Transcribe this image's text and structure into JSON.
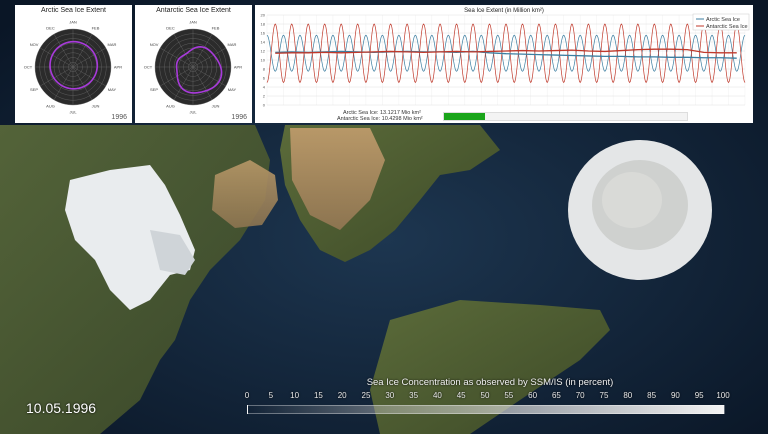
{
  "colors": {
    "arctic": "#3b7ea1",
    "antarctic": "#c0392b",
    "progress": "#1aa51a",
    "polar_trace": "#a93adc"
  },
  "arctic_panel": {
    "title": "Arctic Sea Ice Extent",
    "year": "1996",
    "months": [
      "JAN",
      "FEB",
      "MAR",
      "APR",
      "MAY",
      "JUN",
      "JUL",
      "AUG",
      "SEP",
      "OCT",
      "NOV",
      "DEC"
    ]
  },
  "antarctic_panel": {
    "title": "Antarctic Sea Ice Extent",
    "year": "1996",
    "months": [
      "JAN",
      "FEB",
      "MAR",
      "APR",
      "MAY",
      "JUN",
      "JUL",
      "AUG",
      "SEP",
      "OCT",
      "NOV",
      "DEC"
    ]
  },
  "extent_chart": {
    "title": "Sea Ice Extent (in Million km²)",
    "legend": [
      "Arctic Sea Ice",
      "Antarctic Sea Ice"
    ],
    "readout": {
      "arctic_label": "Arctic Sea Ice:",
      "arctic_value": "13.1217",
      "arctic_unit": "Mio km²",
      "antarctic_label": "Antarctic Sea Ice:",
      "antarctic_value": "10.4298",
      "antarctic_unit": "Mio km²"
    },
    "progress": 0.17
  },
  "chart_data": {
    "type": "line",
    "title": "Sea Ice Extent (in Million km²)",
    "ylim": [
      0,
      20
    ],
    "yticks": [
      "0",
      "2",
      "4",
      "6",
      "8",
      "10",
      "12",
      "14",
      "16",
      "18",
      "20"
    ],
    "cycles": 29,
    "series": [
      {
        "name": "Arctic Sea Ice",
        "mean": 11.5,
        "amplitude": 4,
        "phase": 0
      },
      {
        "name": "Antarctic Sea Ice",
        "mean": 11.5,
        "amplitude": 6.5,
        "phase": 0.5
      },
      {
        "name": "Arctic Sea Ice (annual mean)",
        "values": [
          11.7,
          11.8,
          11.7,
          11.8,
          11.9,
          11.8,
          11.7,
          11.8,
          11.9,
          11.8,
          11.8,
          11.7,
          11.9,
          11.6,
          11.4,
          11.3,
          11.2,
          11.1,
          11.0,
          10.9,
          10.8,
          10.8,
          10.7,
          10.7,
          10.6,
          10.6,
          10.5,
          10.5,
          10.4
        ]
      },
      {
        "name": "Antarctic Sea Ice (annual mean)",
        "values": [
          11.5,
          11.6,
          11.6,
          11.7,
          11.6,
          11.7,
          11.8,
          11.9,
          11.8,
          11.7,
          11.8,
          11.9,
          11.8,
          11.9,
          12.0,
          12.1,
          12.0,
          12.1,
          12.2,
          12.0,
          11.9,
          12.1,
          12.3,
          12.4,
          12.4,
          12.3,
          11.7,
          11.6,
          11.6
        ]
      }
    ]
  },
  "footer": {
    "date": "10.05.1996",
    "colorbar_title": "Sea Ice Concentration as observed by SSM/IS (in percent)",
    "colorbar_ticks": [
      "0",
      "5",
      "10",
      "15",
      "20",
      "25",
      "30",
      "35",
      "40",
      "45",
      "50",
      "55",
      "60",
      "65",
      "70",
      "75",
      "80",
      "85",
      "90",
      "95",
      "100"
    ]
  }
}
